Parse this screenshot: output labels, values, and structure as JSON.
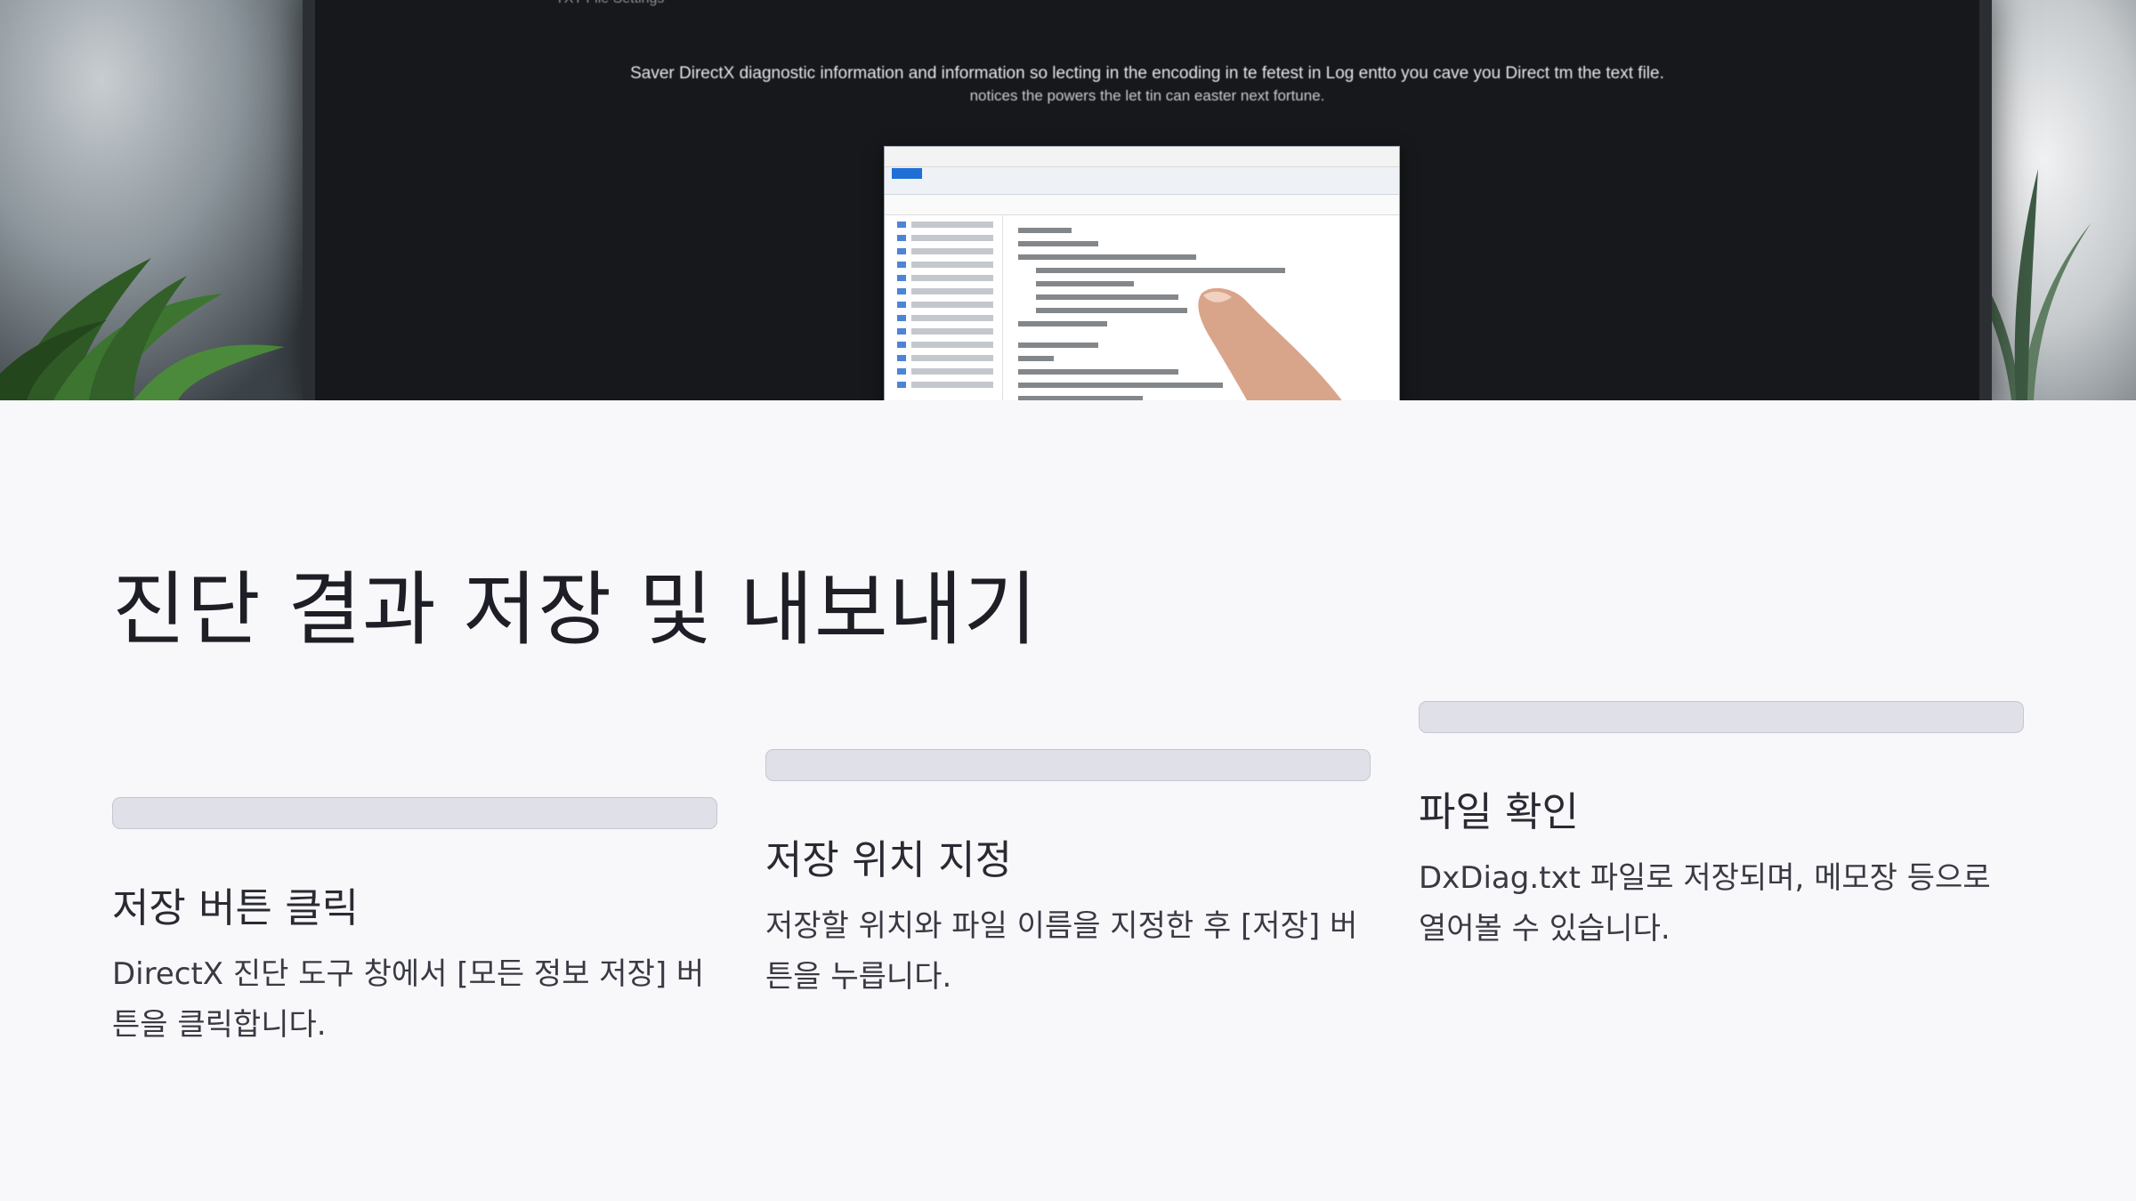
{
  "hero": {
    "image": "monitor-screenshot-photo",
    "monitor_top_text": "TXT File Settings",
    "monitor_line1": "Saver DirectX diagnostic information and information so lecting in the encoding in te fetest in Log entto you cave you Direct tm the text file.",
    "monitor_line2": "notices the powers the let tin can easter next fortune."
  },
  "page": {
    "title": "진단 결과 저장 및 내보내기"
  },
  "steps": [
    {
      "heading": "저장 버튼 클릭",
      "description": "DirectX 진단 도구 창에서 [모든 정보 저장] 버튼을 클릭합니다."
    },
    {
      "heading": "저장 위치 지정",
      "description": "저장할 위치와 파일 이름을 지정한 후 [저장] 버튼을 누릅니다."
    },
    {
      "heading": "파일 확인",
      "description": "DxDiag.txt 파일로 저장되며, 메모장 등으로 열어볼 수 있습니다."
    }
  ],
  "colors": {
    "background": "#f8f8fb",
    "bar": "#dfe0e8",
    "title": "#1e1e26"
  }
}
